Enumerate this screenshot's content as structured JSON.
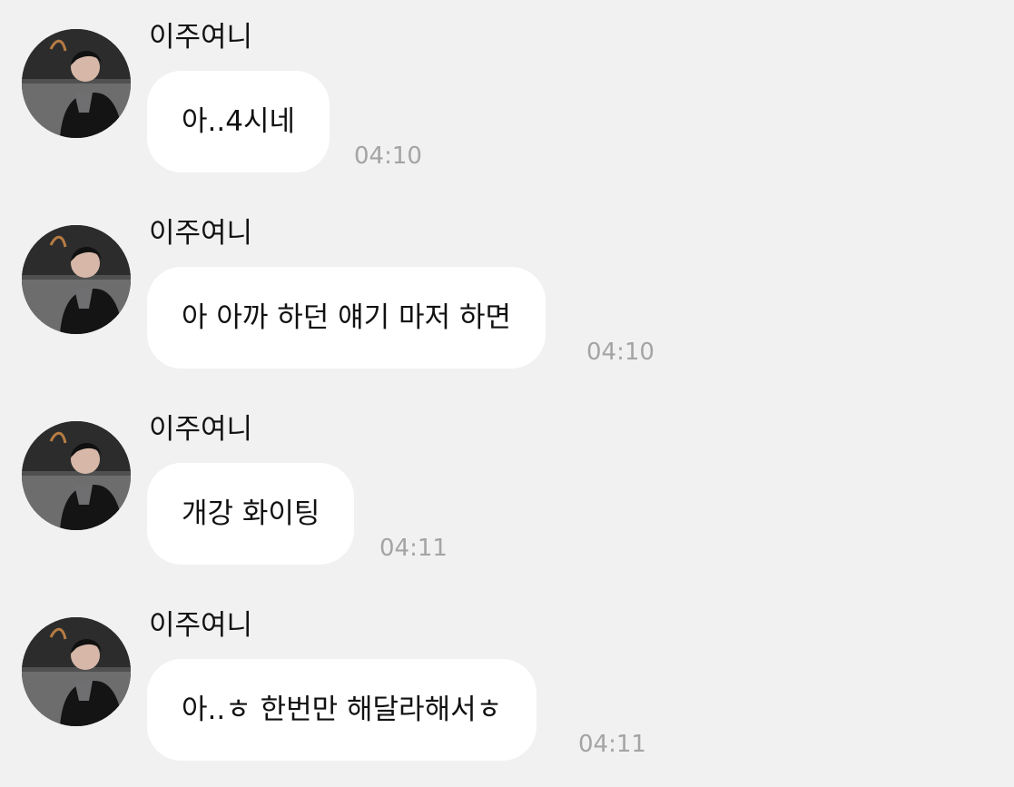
{
  "messages": [
    {
      "sender": "이주여니",
      "text": "아..4시네",
      "time": "04:10",
      "avatar_icon": "profile-avatar-icon"
    },
    {
      "sender": "이주여니",
      "text": "아 아까 하던 얘기 마저 하면",
      "time": "04:10",
      "avatar_icon": "profile-avatar-icon"
    },
    {
      "sender": "이주여니",
      "text": "개강 화이팅",
      "time": "04:11",
      "avatar_icon": "profile-avatar-icon"
    },
    {
      "sender": "이주여니",
      "text": "아..ㅎ 한번만 해달라해서ㅎ",
      "time": "04:11",
      "avatar_icon": "profile-avatar-icon"
    }
  ],
  "colors": {
    "background": "#f1f1f1",
    "bubble": "#ffffff",
    "text": "#111111",
    "time": "#a4a4a4"
  }
}
